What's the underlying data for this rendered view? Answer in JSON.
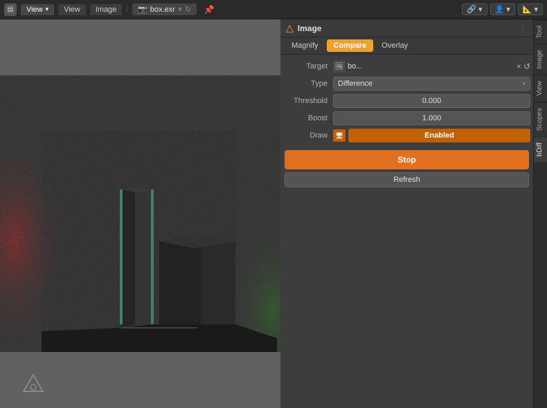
{
  "header": {
    "left_icon": "▤",
    "menus": [
      "View",
      "View",
      "Image"
    ],
    "separator": "|",
    "filename": "box.exr",
    "close_label": "×",
    "pin_label": "📌",
    "right_icons": [
      "🔗",
      "👤",
      "📐"
    ]
  },
  "panel": {
    "header_icon": "△",
    "title": "Image",
    "dots": "⋮",
    "tabs": [
      {
        "label": "Magnify",
        "active": false
      },
      {
        "label": "Compare",
        "active": true
      },
      {
        "label": "Overlay",
        "active": false
      }
    ]
  },
  "properties": {
    "target_label": "Target",
    "target_icon": "🖼",
    "target_name": "bo...",
    "target_x": "×",
    "target_refresh": "↺",
    "type_label": "Type",
    "type_value": "Difference",
    "type_arrow": "▾",
    "threshold_label": "Threshold",
    "threshold_value": "0.000",
    "boost_label": "Boost",
    "boost_value": "1.000",
    "draw_label": "Draw",
    "draw_icon": "🖥",
    "draw_enabled": "Enabled"
  },
  "buttons": {
    "stop_label": "Stop",
    "refresh_label": "Refresh"
  },
  "side_tabs": [
    {
      "label": "Tool",
      "active": false
    },
    {
      "label": "Image",
      "active": false
    },
    {
      "label": "View",
      "active": false
    },
    {
      "label": "Scopes",
      "active": false
    },
    {
      "label": "bDiff",
      "active": true
    }
  ],
  "colors": {
    "orange": "#e07020",
    "panel_bg": "#3a3a3a",
    "input_bg": "#545454",
    "active_tab": "#f0a030"
  },
  "blender_logo": "△"
}
